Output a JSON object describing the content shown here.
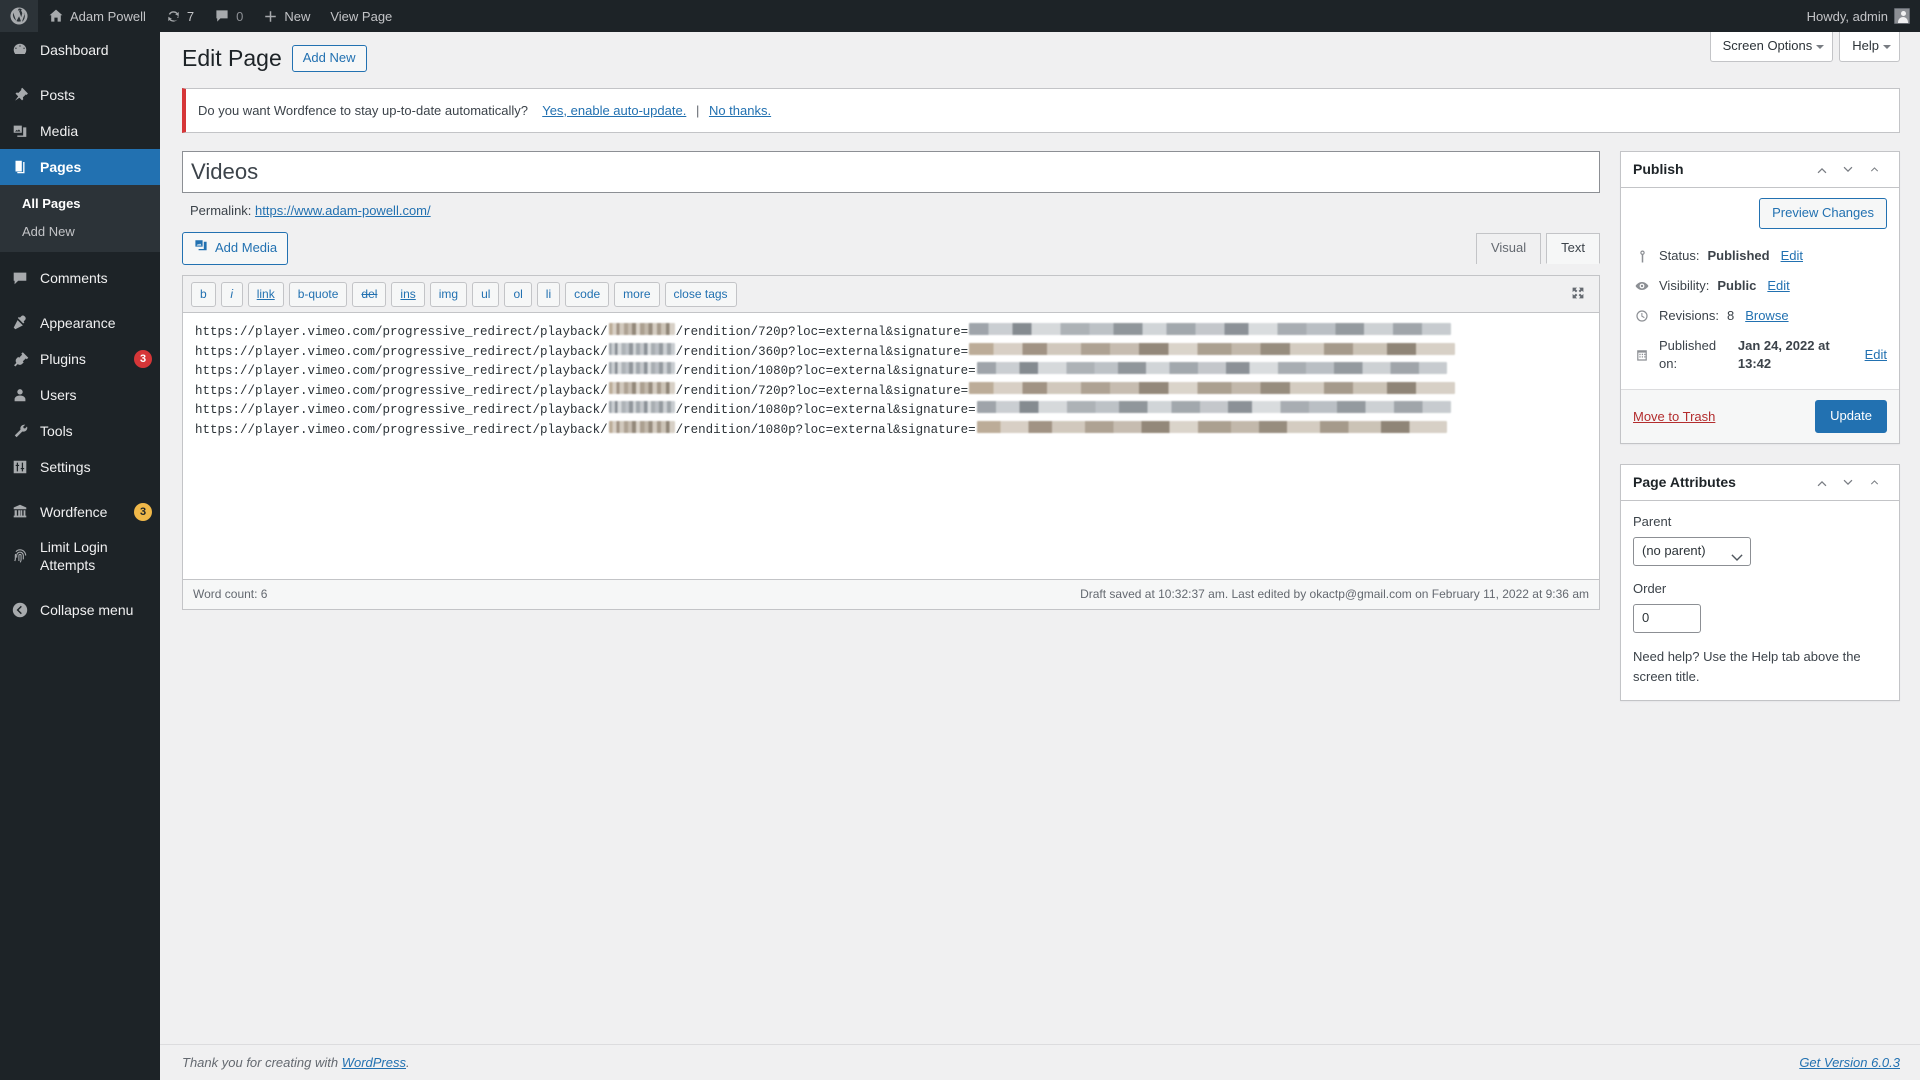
{
  "adminbar": {
    "wp_logo": "wordpress-logo",
    "site_name": "Adam Powell",
    "updates_count": "7",
    "comments_count": "0",
    "new_label": "New",
    "view_page_label": "View Page",
    "howdy": "Howdy, admin"
  },
  "sidebar": {
    "items": [
      {
        "label": "Dashboard",
        "icon": "dashboard-icon",
        "badge": ""
      },
      {
        "label": "Posts",
        "icon": "pin-icon",
        "badge": ""
      },
      {
        "label": "Media",
        "icon": "media-icon",
        "badge": ""
      },
      {
        "label": "Pages",
        "icon": "pages-icon",
        "badge": "",
        "current": true
      },
      {
        "label": "Comments",
        "icon": "comments-icon",
        "badge": ""
      },
      {
        "label": "Appearance",
        "icon": "appearance-icon",
        "badge": ""
      },
      {
        "label": "Plugins",
        "icon": "plugins-icon",
        "badge": "3"
      },
      {
        "label": "Users",
        "icon": "users-icon",
        "badge": ""
      },
      {
        "label": "Tools",
        "icon": "tools-icon",
        "badge": ""
      },
      {
        "label": "Settings",
        "icon": "settings-icon",
        "badge": ""
      },
      {
        "label": "Wordfence",
        "icon": "wordfence-icon",
        "badge": "3"
      },
      {
        "label": "Limit Login Attempts",
        "icon": "fingerprint-icon",
        "badge": ""
      }
    ],
    "submenu": [
      {
        "label": "All Pages",
        "current": true
      },
      {
        "label": "Add New",
        "current": false
      }
    ],
    "collapse_label": "Collapse menu"
  },
  "screen_meta": {
    "screen_options": "Screen Options",
    "help": "Help"
  },
  "header": {
    "title": "Edit Page",
    "add_new": "Add New"
  },
  "notice": {
    "text": "Do you want Wordfence to stay up-to-date automatically?",
    "link_yes": "Yes, enable auto-update.",
    "separator": "|",
    "link_no": "No thanks."
  },
  "post": {
    "title": "Videos",
    "title_placeholder": "Add title",
    "permalink_label": "Permalink:",
    "permalink_url": "https://www.adam-powell.com/"
  },
  "editor": {
    "add_media": "Add Media",
    "tabs": [
      {
        "label": "Visual",
        "active": false
      },
      {
        "label": "Text",
        "active": true
      }
    ],
    "quicktags": [
      "b",
      "i",
      "link",
      "b-quote",
      "del",
      "ins",
      "img",
      "ul",
      "ol",
      "li",
      "code",
      "more",
      "close tags"
    ],
    "fullscreen_icon": "fullscreen-icon",
    "content_lines": [
      {
        "prefix": "https://player.vimeo.com/progressive_redirect/playback/",
        "id_width": 66,
        "id_tone": "warm",
        "mid": "/rendition/720p?loc=external&signature=",
        "sig_width": 482,
        "sig_tone": "cool"
      },
      {
        "prefix": "https://player.vimeo.com/progressive_redirect/playback/",
        "id_width": 66,
        "id_tone": "cool",
        "mid": "/rendition/360p?loc=external&signature=",
        "sig_width": 486,
        "sig_tone": "warm"
      },
      {
        "prefix": "https://player.vimeo.com/progressive_redirect/playback/",
        "id_width": 66,
        "id_tone": "cool",
        "mid": "/rendition/1080p?loc=external&signature=",
        "sig_width": 470,
        "sig_tone": "cool"
      },
      {
        "prefix": "https://player.vimeo.com/progressive_redirect/playback/",
        "id_width": 66,
        "id_tone": "warm",
        "mid": "/rendition/720p?loc=external&signature=",
        "sig_width": 486,
        "sig_tone": "warm"
      },
      {
        "prefix": "https://player.vimeo.com/progressive_redirect/playback/",
        "id_width": 66,
        "id_tone": "cool",
        "mid": "/rendition/1080p?loc=external&signature=",
        "sig_width": 474,
        "sig_tone": "cool"
      },
      {
        "prefix": "https://player.vimeo.com/progressive_redirect/playback/",
        "id_width": 66,
        "id_tone": "warm",
        "mid": "/rendition/1080p?loc=external&signature=",
        "sig_width": 470,
        "sig_tone": "warm"
      }
    ],
    "word_count": "Word count: 6",
    "save_status": "Draft saved at 10:32:37 am. Last edited by okactp@gmail.com on February 11, 2022 at 9:36 am"
  },
  "publish_box": {
    "title": "Publish",
    "preview_button": "Preview Changes",
    "status_label": "Status:",
    "status_value": "Published",
    "status_edit": "Edit",
    "visibility_label": "Visibility:",
    "visibility_value": "Public",
    "visibility_edit": "Edit",
    "revisions_label": "Revisions:",
    "revisions_value": "8",
    "revisions_browse": "Browse",
    "published_label": "Published on:",
    "published_value": "Jan 24, 2022 at 13:42",
    "published_edit": "Edit",
    "trash_label": "Move to Trash",
    "update_label": "Update"
  },
  "page_attributes": {
    "title": "Page Attributes",
    "parent_label": "Parent",
    "parent_value": "(no parent)",
    "order_label": "Order",
    "order_value": "0",
    "help_text": "Need help? Use the Help tab above the screen title."
  },
  "footer": {
    "thanks_prefix": "Thank you for creating with",
    "wordpress_link": "WordPress",
    "period": ".",
    "version": "Get Version 6.0.3"
  },
  "colors": {
    "admin_bg": "#1d2327",
    "accent": "#2271b1",
    "badge_red": "#d63638",
    "badge_orange": "#f0b849",
    "body_bg": "#f0f0f1"
  }
}
